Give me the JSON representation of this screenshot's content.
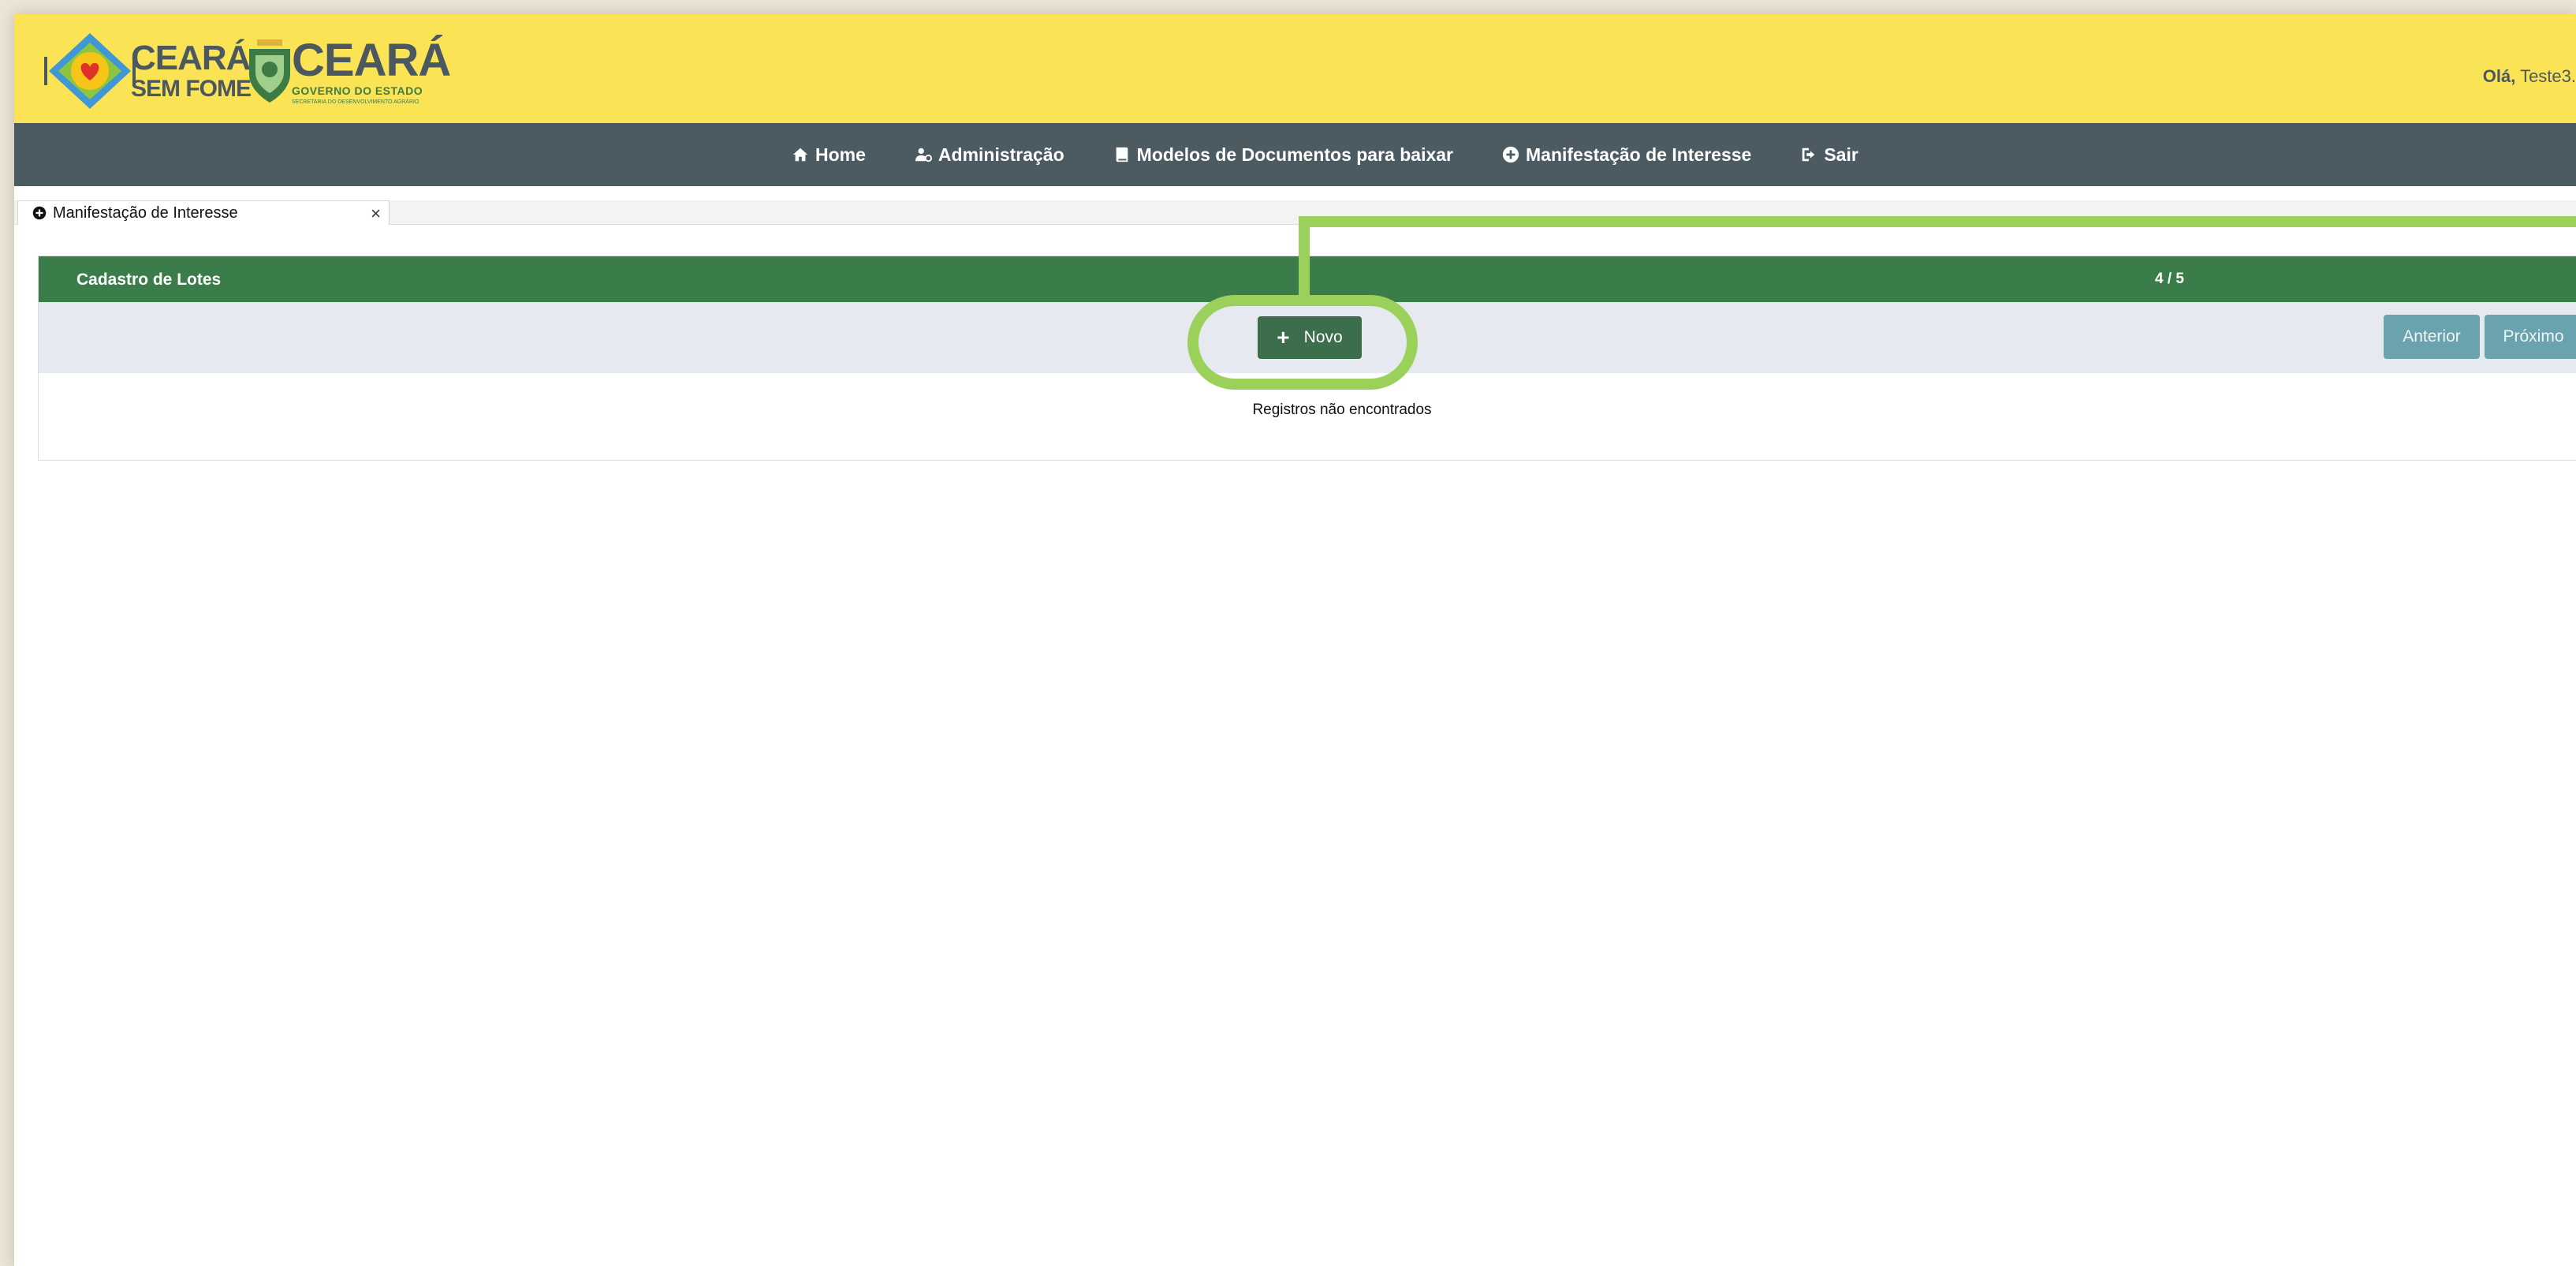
{
  "header": {
    "logo1_line1": "CEARÁ",
    "logo1_line2": "SEM FOME",
    "logo2_line1": "CEARÁ",
    "logo2_line2": "GOVERNO DO ESTADO",
    "logo2_line3": "SECRETARIA DO DESENVOLVIMENTO AGRÁRIO",
    "greeting_label": "Olá,",
    "greeting_user": "Teste3."
  },
  "nav": {
    "items": [
      {
        "label": "Home",
        "icon": "home-icon"
      },
      {
        "label": "Administração",
        "icon": "user-gear-icon"
      },
      {
        "label": "Modelos de Documentos para baixar",
        "icon": "book-icon"
      },
      {
        "label": "Manifestação de Interesse",
        "icon": "plus-circle-icon"
      },
      {
        "label": "Sair",
        "icon": "sign-out-icon"
      }
    ]
  },
  "tab": {
    "label": "Manifestação de Interesse",
    "icon": "plus-circle-icon",
    "close": "×"
  },
  "panel": {
    "title": "Cadastro de Lotes",
    "step": "4 / 5",
    "new_button": "Novo",
    "new_icon": "+",
    "prev_button": "Anterior",
    "next_button": "Próximo",
    "empty_message": "Registros não encontrados"
  },
  "colors": {
    "header_bg": "#fbe356",
    "nav_bg": "#4b5b61",
    "panel_head": "#3a7d4a",
    "primary_button": "#3c6e4c",
    "secondary_button": "#6aa2ad",
    "highlight": "#9bd15b"
  }
}
